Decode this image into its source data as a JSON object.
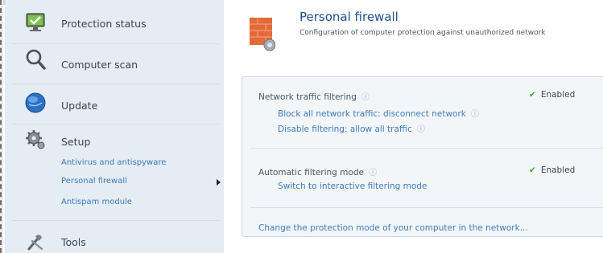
{
  "sidebar": {
    "items": [
      {
        "label": "Protection status",
        "icon": "monitor-check-icon"
      },
      {
        "label": "Computer scan",
        "icon": "magnifier-icon"
      },
      {
        "label": "Update",
        "icon": "globe-icon"
      },
      {
        "label": "Setup",
        "icon": "gear-icon",
        "sub_items": [
          "Antivirus and antispyware",
          "Personal firewall",
          "Antispam module"
        ]
      },
      {
        "label": "Tools",
        "icon": "tools-icon"
      }
    ]
  },
  "main": {
    "title": "Personal firewall",
    "subtitle": "Configuration of computer protection against unauthorized network",
    "network_filtering": {
      "label": "Network traffic filtering",
      "status": "Enabled",
      "links": [
        "Block all network traffic: disconnect network",
        "Disable filtering: allow all traffic"
      ]
    },
    "auto_filtering": {
      "label": "Automatic filtering mode",
      "status": "Enabled",
      "links": [
        "Switch to interactive filtering mode"
      ]
    },
    "bottom_link": "Change the protection mode of your computer in the network..."
  },
  "colors": {
    "sidebar_bg": "#e4ecf4",
    "link": "#3f7cba",
    "title": "#1e4f8c",
    "check": "#3ea33a"
  }
}
